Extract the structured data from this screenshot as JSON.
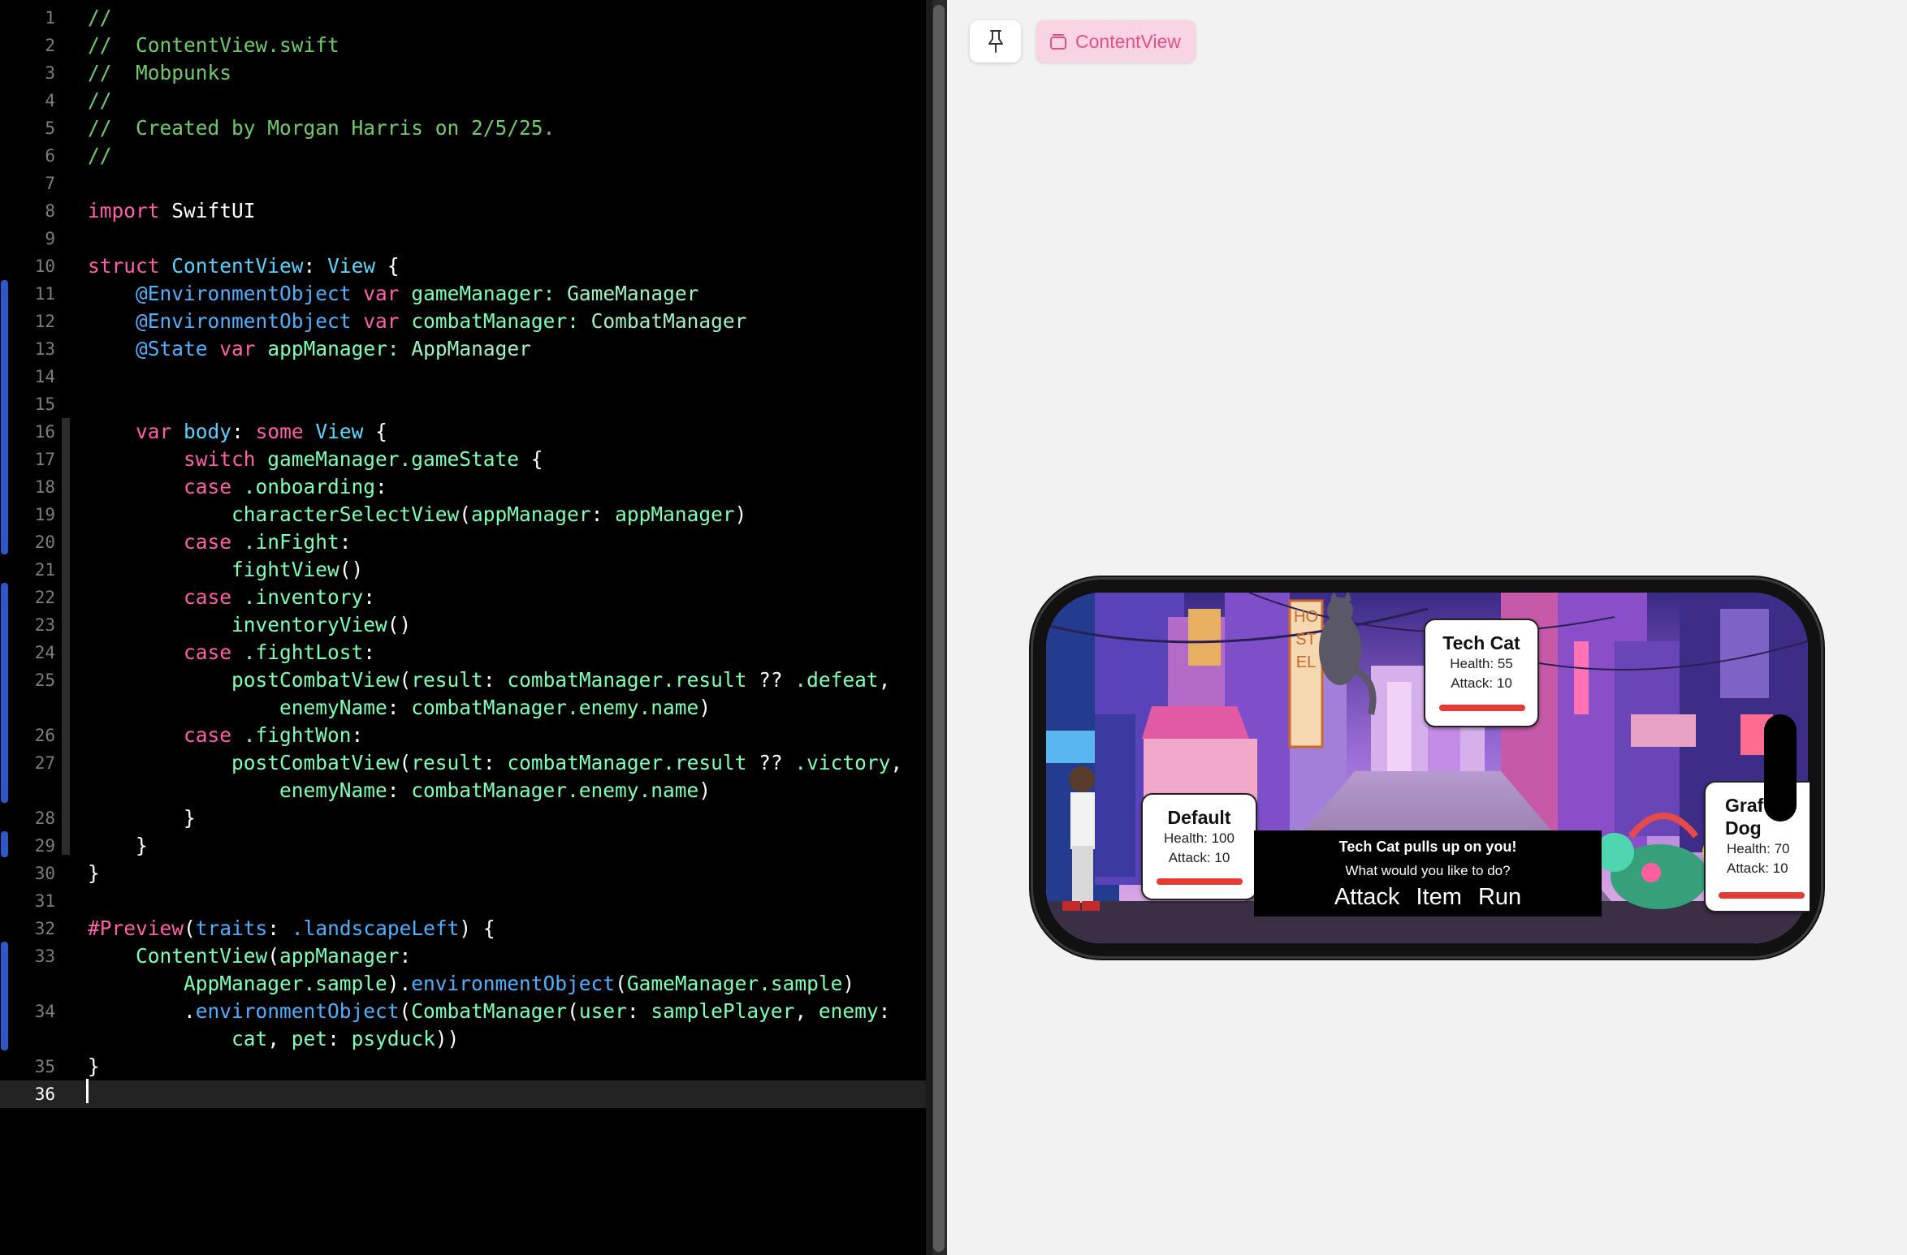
{
  "editor": {
    "lines": [
      {
        "n": "1",
        "tokens": [
          {
            "t": "//",
            "c": "comment"
          }
        ]
      },
      {
        "n": "2",
        "tokens": [
          {
            "t": "//  ContentView.swift",
            "c": "comment"
          }
        ]
      },
      {
        "n": "3",
        "tokens": [
          {
            "t": "//  Mobpunks",
            "c": "comment"
          }
        ]
      },
      {
        "n": "4",
        "tokens": [
          {
            "t": "//",
            "c": "comment"
          }
        ]
      },
      {
        "n": "5",
        "tokens": [
          {
            "t": "//  Created by Morgan Harris on 2/5/25.",
            "c": "comment"
          }
        ]
      },
      {
        "n": "6",
        "tokens": [
          {
            "t": "//",
            "c": "comment"
          }
        ]
      },
      {
        "n": "7",
        "tokens": []
      },
      {
        "n": "8",
        "tokens": [
          {
            "t": "import",
            "c": "kw"
          },
          {
            "t": " SwiftUI",
            "c": "plain"
          }
        ]
      },
      {
        "n": "9",
        "tokens": []
      },
      {
        "n": "10",
        "tokens": [
          {
            "t": "struct",
            "c": "kw"
          },
          {
            "t": " ",
            "c": "plain"
          },
          {
            "t": "ContentView",
            "c": "def"
          },
          {
            "t": ": ",
            "c": "plain"
          },
          {
            "t": "View",
            "c": "type"
          },
          {
            "t": " {",
            "c": "plain"
          }
        ]
      },
      {
        "n": "11",
        "tokens": [
          {
            "t": "    ",
            "c": "plain"
          },
          {
            "t": "@EnvironmentObject",
            "c": "anno"
          },
          {
            "t": " ",
            "c": "plain"
          },
          {
            "t": "var",
            "c": "kw"
          },
          {
            "t": " gameManager: ",
            "c": "prop"
          },
          {
            "t": "GameManager",
            "c": "type2"
          }
        ]
      },
      {
        "n": "12",
        "tokens": [
          {
            "t": "    ",
            "c": "plain"
          },
          {
            "t": "@EnvironmentObject",
            "c": "anno"
          },
          {
            "t": " ",
            "c": "plain"
          },
          {
            "t": "var",
            "c": "kw"
          },
          {
            "t": " combatManager: ",
            "c": "prop"
          },
          {
            "t": "CombatManager",
            "c": "type2"
          }
        ]
      },
      {
        "n": "13",
        "tokens": [
          {
            "t": "    ",
            "c": "plain"
          },
          {
            "t": "@State",
            "c": "anno"
          },
          {
            "t": " ",
            "c": "plain"
          },
          {
            "t": "var",
            "c": "kw"
          },
          {
            "t": " appManager: ",
            "c": "prop"
          },
          {
            "t": "AppManager",
            "c": "type2"
          }
        ]
      },
      {
        "n": "14",
        "tokens": []
      },
      {
        "n": "15",
        "tokens": []
      },
      {
        "n": "16",
        "tokens": [
          {
            "t": "    ",
            "c": "plain"
          },
          {
            "t": "var",
            "c": "kw"
          },
          {
            "t": " ",
            "c": "plain"
          },
          {
            "t": "body",
            "c": "def"
          },
          {
            "t": ": ",
            "c": "plain"
          },
          {
            "t": "some",
            "c": "kw"
          },
          {
            "t": " ",
            "c": "plain"
          },
          {
            "t": "View",
            "c": "type"
          },
          {
            "t": " {",
            "c": "plain"
          }
        ]
      },
      {
        "n": "17",
        "tokens": [
          {
            "t": "        ",
            "c": "plain"
          },
          {
            "t": "switch",
            "c": "kw"
          },
          {
            "t": " gameManager.gameState",
            "c": "member"
          },
          {
            "t": " {",
            "c": "plain"
          }
        ]
      },
      {
        "n": "18",
        "tokens": [
          {
            "t": "        ",
            "c": "plain"
          },
          {
            "t": "case",
            "c": "kw"
          },
          {
            "t": " .onboarding",
            "c": "member"
          },
          {
            "t": ":",
            "c": "plain"
          }
        ]
      },
      {
        "n": "19",
        "tokens": [
          {
            "t": "            ",
            "c": "plain"
          },
          {
            "t": "characterSelectView",
            "c": "fn"
          },
          {
            "t": "(",
            "c": "plain"
          },
          {
            "t": "appManager",
            "c": "member"
          },
          {
            "t": ": ",
            "c": "plain"
          },
          {
            "t": "appManager",
            "c": "member"
          },
          {
            "t": ")",
            "c": "plain"
          }
        ]
      },
      {
        "n": "20",
        "tokens": [
          {
            "t": "        ",
            "c": "plain"
          },
          {
            "t": "case",
            "c": "kw"
          },
          {
            "t": " .inFight",
            "c": "member"
          },
          {
            "t": ":",
            "c": "plain"
          }
        ]
      },
      {
        "n": "21",
        "tokens": [
          {
            "t": "            ",
            "c": "plain"
          },
          {
            "t": "fightView",
            "c": "fn"
          },
          {
            "t": "()",
            "c": "plain"
          }
        ]
      },
      {
        "n": "22",
        "tokens": [
          {
            "t": "        ",
            "c": "plain"
          },
          {
            "t": "case",
            "c": "kw"
          },
          {
            "t": " .inventory",
            "c": "member"
          },
          {
            "t": ":",
            "c": "plain"
          }
        ]
      },
      {
        "n": "23",
        "tokens": [
          {
            "t": "            ",
            "c": "plain"
          },
          {
            "t": "inventoryView",
            "c": "fn"
          },
          {
            "t": "()",
            "c": "plain"
          }
        ]
      },
      {
        "n": "24",
        "tokens": [
          {
            "t": "        ",
            "c": "plain"
          },
          {
            "t": "case",
            "c": "kw"
          },
          {
            "t": " .fightLost",
            "c": "member"
          },
          {
            "t": ":",
            "c": "plain"
          }
        ]
      },
      {
        "n": "25",
        "tokens": [
          {
            "t": "            ",
            "c": "plain"
          },
          {
            "t": "postCombatView",
            "c": "fn"
          },
          {
            "t": "(",
            "c": "plain"
          },
          {
            "t": "result",
            "c": "member"
          },
          {
            "t": ": ",
            "c": "plain"
          },
          {
            "t": "combatManager.result",
            "c": "member"
          },
          {
            "t": " ?? ",
            "c": "plain"
          },
          {
            "t": ".defeat",
            "c": "member"
          },
          {
            "t": ",",
            "c": "plain"
          }
        ]
      },
      {
        "n": "",
        "tokens": [
          {
            "t": "                ",
            "c": "plain"
          },
          {
            "t": "enemyName",
            "c": "member"
          },
          {
            "t": ": ",
            "c": "plain"
          },
          {
            "t": "combatManager.enemy.name",
            "c": "member"
          },
          {
            "t": ")",
            "c": "plain"
          }
        ]
      },
      {
        "n": "26",
        "tokens": [
          {
            "t": "        ",
            "c": "plain"
          },
          {
            "t": "case",
            "c": "kw"
          },
          {
            "t": " .fightWon",
            "c": "member"
          },
          {
            "t": ":",
            "c": "plain"
          }
        ]
      },
      {
        "n": "27",
        "tokens": [
          {
            "t": "            ",
            "c": "plain"
          },
          {
            "t": "postCombatView",
            "c": "fn"
          },
          {
            "t": "(",
            "c": "plain"
          },
          {
            "t": "result",
            "c": "member"
          },
          {
            "t": ": ",
            "c": "plain"
          },
          {
            "t": "combatManager.result",
            "c": "member"
          },
          {
            "t": " ?? ",
            "c": "plain"
          },
          {
            "t": ".victory",
            "c": "member"
          },
          {
            "t": ",",
            "c": "plain"
          }
        ]
      },
      {
        "n": "",
        "tokens": [
          {
            "t": "                ",
            "c": "plain"
          },
          {
            "t": "enemyName",
            "c": "member"
          },
          {
            "t": ": ",
            "c": "plain"
          },
          {
            "t": "combatManager.enemy.name",
            "c": "member"
          },
          {
            "t": ")",
            "c": "plain"
          }
        ]
      },
      {
        "n": "28",
        "tokens": [
          {
            "t": "        }",
            "c": "plain"
          }
        ]
      },
      {
        "n": "29",
        "tokens": [
          {
            "t": "    }",
            "c": "plain"
          }
        ]
      },
      {
        "n": "30",
        "tokens": [
          {
            "t": "}",
            "c": "plain"
          }
        ]
      },
      {
        "n": "31",
        "tokens": []
      },
      {
        "n": "32",
        "tokens": [
          {
            "t": "#Preview",
            "c": "kw"
          },
          {
            "t": "(",
            "c": "plain"
          },
          {
            "t": "traits",
            "c": "anno"
          },
          {
            "t": ": ",
            "c": "plain"
          },
          {
            "t": ".landscapeLeft",
            "c": "anno"
          },
          {
            "t": ") {",
            "c": "plain"
          }
        ]
      },
      {
        "n": "33",
        "tokens": [
          {
            "t": "    ",
            "c": "plain"
          },
          {
            "t": "ContentView",
            "c": "member"
          },
          {
            "t": "(",
            "c": "plain"
          },
          {
            "t": "appManager",
            "c": "member"
          },
          {
            "t": ":",
            "c": "plain"
          }
        ]
      },
      {
        "n": "",
        "tokens": [
          {
            "t": "        ",
            "c": "plain"
          },
          {
            "t": "AppManager.sample",
            "c": "member"
          },
          {
            "t": ").",
            "c": "plain"
          },
          {
            "t": "environmentObject",
            "c": "anno"
          },
          {
            "t": "(",
            "c": "plain"
          },
          {
            "t": "GameManager.sample",
            "c": "member"
          },
          {
            "t": ")",
            "c": "plain"
          }
        ]
      },
      {
        "n": "34",
        "tokens": [
          {
            "t": "        .",
            "c": "plain"
          },
          {
            "t": "environmentObject",
            "c": "anno"
          },
          {
            "t": "(",
            "c": "plain"
          },
          {
            "t": "CombatManager",
            "c": "member"
          },
          {
            "t": "(",
            "c": "plain"
          },
          {
            "t": "user",
            "c": "member"
          },
          {
            "t": ": ",
            "c": "plain"
          },
          {
            "t": "samplePlayer",
            "c": "member"
          },
          {
            "t": ", ",
            "c": "plain"
          },
          {
            "t": "enemy",
            "c": "member"
          },
          {
            "t": ":",
            "c": "plain"
          }
        ]
      },
      {
        "n": "",
        "tokens": [
          {
            "t": "            ",
            "c": "plain"
          },
          {
            "t": "cat",
            "c": "member"
          },
          {
            "t": ", ",
            "c": "plain"
          },
          {
            "t": "pet",
            "c": "member"
          },
          {
            "t": ": ",
            "c": "plain"
          },
          {
            "t": "psyduck",
            "c": "member"
          },
          {
            "t": "))",
            "c": "plain"
          }
        ]
      },
      {
        "n": "35",
        "tokens": [
          {
            "t": "}",
            "c": "plain"
          }
        ]
      },
      {
        "n": "36",
        "tokens": [],
        "current": true
      }
    ]
  },
  "canvas": {
    "pin_icon": "pin-icon",
    "chip_icon": "stack-icon",
    "chip_label": "ContentView"
  },
  "game": {
    "enemy": {
      "name": "Tech Cat",
      "health": "Health: 55",
      "attack": "Attack: 10",
      "health_fraction": 1.0
    },
    "player": {
      "name": "Default",
      "health": "Health: 100",
      "attack": "Attack: 10",
      "health_fraction": 1.0
    },
    "pet": {
      "name": "Graf Dog",
      "health": "Health: 70",
      "attack": "Attack: 10",
      "health_fraction": 1.0
    },
    "dialog": {
      "message": "Tech Cat pulls up on you!",
      "question": "What would you like to do?",
      "actions": [
        "Attack",
        "Item",
        "Run"
      ]
    },
    "sign_text": "HOSTEL"
  }
}
